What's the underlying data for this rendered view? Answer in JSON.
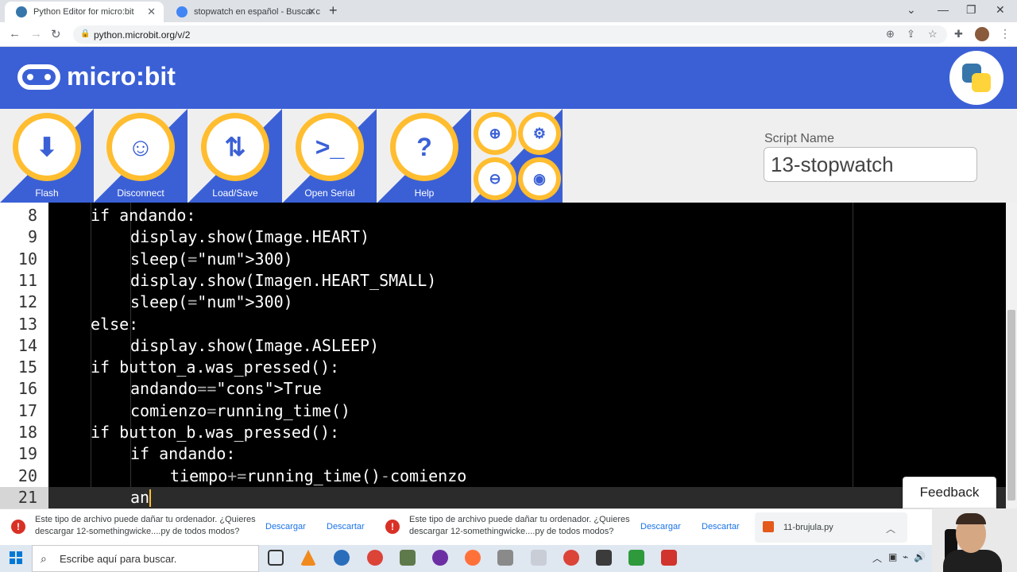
{
  "browser": {
    "tabs": [
      {
        "title": "Python Editor for micro:bit",
        "active": true
      },
      {
        "title": "stopwatch en español - Buscar c",
        "active": false
      }
    ],
    "url": "python.microbit.org/v/2"
  },
  "app": {
    "logo_text": "micro:bit",
    "toolbar": [
      {
        "label": "Flash",
        "icon": "download-icon"
      },
      {
        "label": "Disconnect",
        "icon": "robot-face-icon"
      },
      {
        "label": "Load/Save",
        "icon": "load-save-icon"
      },
      {
        "label": "Open Serial",
        "icon": "terminal-icon"
      },
      {
        "label": "Help",
        "icon": "question-icon"
      }
    ],
    "small_buttons": [
      "zoom-in-icon",
      "settings-icon",
      "zoom-out-icon",
      "language-icon"
    ],
    "script_name_label": "Script Name",
    "script_name_value": "13-stopwatch"
  },
  "editor": {
    "lines": [
      {
        "n": "8",
        "indent": 0,
        "text": "if andando:"
      },
      {
        "n": "9",
        "indent": 1,
        "text": "display.show(Image.HEART)"
      },
      {
        "n": "10",
        "indent": 1,
        "text": "sleep(300)"
      },
      {
        "n": "11",
        "indent": 1,
        "text": "display.show(Imagen.HEART_SMALL)"
      },
      {
        "n": "12",
        "indent": 1,
        "text": "sleep(300)"
      },
      {
        "n": "13",
        "indent": 0,
        "text": "else:"
      },
      {
        "n": "14",
        "indent": 1,
        "text": "display.show(Image.ASLEEP)"
      },
      {
        "n": "15",
        "indent": 0,
        "text": "if button_a.was_pressed():"
      },
      {
        "n": "16",
        "indent": 1,
        "text": "andando=True"
      },
      {
        "n": "17",
        "indent": 1,
        "text": "comienzo=running_time()"
      },
      {
        "n": "18",
        "indent": 0,
        "text": "if button_b.was_pressed():"
      },
      {
        "n": "19",
        "indent": 1,
        "text": "if andando:"
      },
      {
        "n": "20",
        "indent": 2,
        "text": "tiempo+=running_time()-comienzo"
      },
      {
        "n": "21",
        "indent": 1,
        "text": "an"
      }
    ]
  },
  "feedback_label": "Feedback",
  "downloads": [
    {
      "message": "Este tipo de archivo puede dañar tu ordenador. ¿Quieres descargar 12-somethingwicke....py de todos modos?",
      "keep": "Descargar",
      "discard": "Descartar"
    },
    {
      "message": "Este tipo de archivo puede dañar tu ordenador. ¿Quieres descargar 12-somethingwicke....py de todos modos?",
      "keep": "Descargar",
      "discard": "Descartar"
    }
  ],
  "download_file": "11-brujula.py",
  "taskbar": {
    "search_placeholder": "Escribe aquí para buscar."
  }
}
